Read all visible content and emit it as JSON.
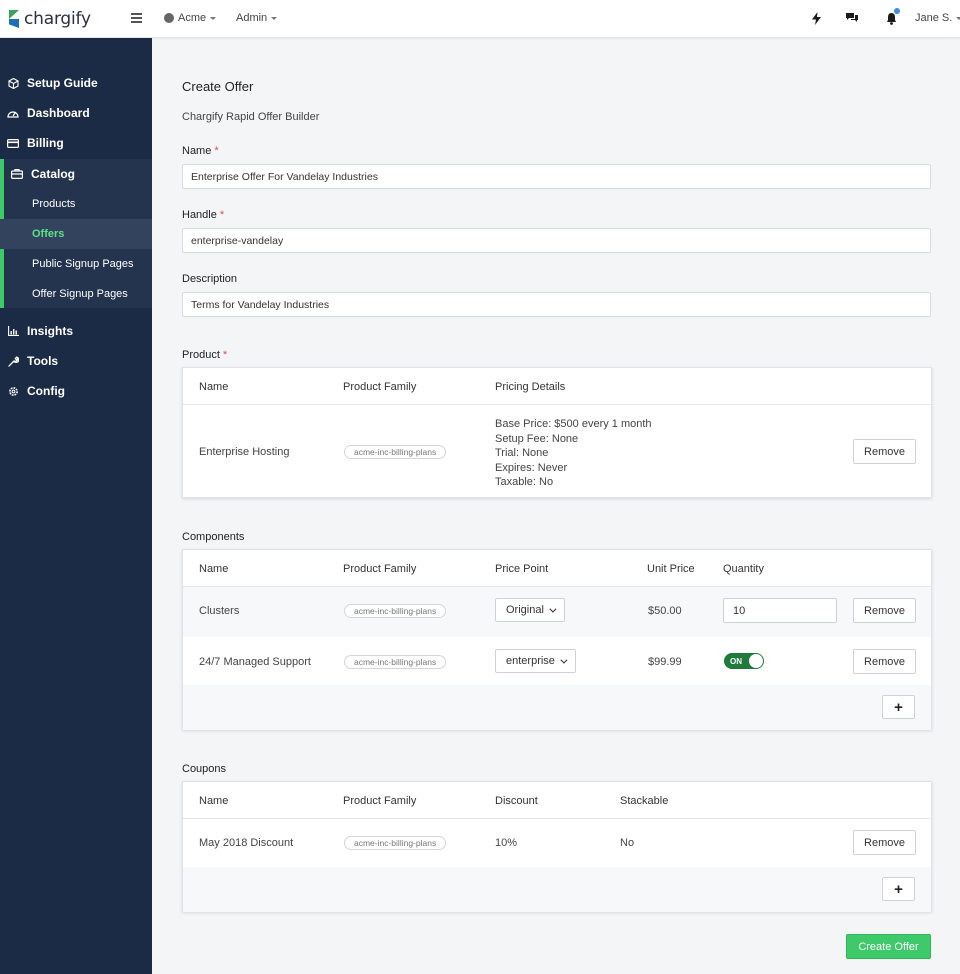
{
  "topbar": {
    "brand": "chargify",
    "account": "Acme",
    "role": "Admin",
    "user": "Jane S.",
    "icons": [
      "menu-icon",
      "bolt-icon",
      "chat-icon",
      "bell-icon"
    ]
  },
  "sidebar": {
    "items": [
      {
        "label": "Setup Guide",
        "icon": "box-icon"
      },
      {
        "label": "Dashboard",
        "icon": "gauge-icon"
      },
      {
        "label": "Billing",
        "icon": "card-icon"
      },
      {
        "label": "Catalog",
        "icon": "catalog-icon"
      },
      {
        "label": "Insights",
        "icon": "chart-icon"
      },
      {
        "label": "Tools",
        "icon": "wrench-icon"
      },
      {
        "label": "Config",
        "icon": "gear-icon"
      }
    ],
    "catalog_sub": [
      "Products",
      "Offers",
      "Public Signup Pages",
      "Offer Signup Pages"
    ],
    "active_sub": "Offers",
    "accent_color": "#3ec96b"
  },
  "page": {
    "title": "Create Offer",
    "subtitle": "Chargify Rapid Offer Builder"
  },
  "form": {
    "name_label": "Name",
    "name_value": "Enterprise Offer For Vandelay Industries",
    "handle_label": "Handle",
    "handle_value": "enterprise-vandelay",
    "description_label": "Description",
    "description_value": "Terms for Vandelay Industries",
    "required_mark": "*"
  },
  "product": {
    "label": "Product",
    "headers": [
      "Name",
      "Product Family",
      "Pricing Details"
    ],
    "row": {
      "name": "Enterprise Hosting",
      "family": "acme-inc-billing-plans",
      "pricing": [
        "Base Price: $500 every 1 month",
        "Setup Fee: None",
        "Trial: None",
        "Expires: Never",
        "Taxable: No"
      ],
      "remove": "Remove"
    }
  },
  "components": {
    "label": "Components",
    "headers": [
      "Name",
      "Product Family",
      "Price Point",
      "Unit Price",
      "Quantity"
    ],
    "rows": [
      {
        "name": "Clusters",
        "family": "acme-inc-billing-plans",
        "price_point": "Original",
        "unit_price": "$50.00",
        "quantity": "10",
        "remove": "Remove"
      },
      {
        "name": "24/7 Managed Support",
        "family": "acme-inc-billing-plans",
        "price_point": "enterprise",
        "unit_price": "$99.99",
        "toggle": "ON",
        "remove": "Remove"
      }
    ],
    "add": "+"
  },
  "coupons": {
    "label": "Coupons",
    "headers": [
      "Name",
      "Product Family",
      "Discount",
      "Stackable"
    ],
    "row": {
      "name": "May 2018 Discount",
      "family": "acme-inc-billing-plans",
      "discount": "10%",
      "stackable": "No",
      "remove": "Remove"
    },
    "add": "+"
  },
  "actions": {
    "create": "Create Offer"
  }
}
